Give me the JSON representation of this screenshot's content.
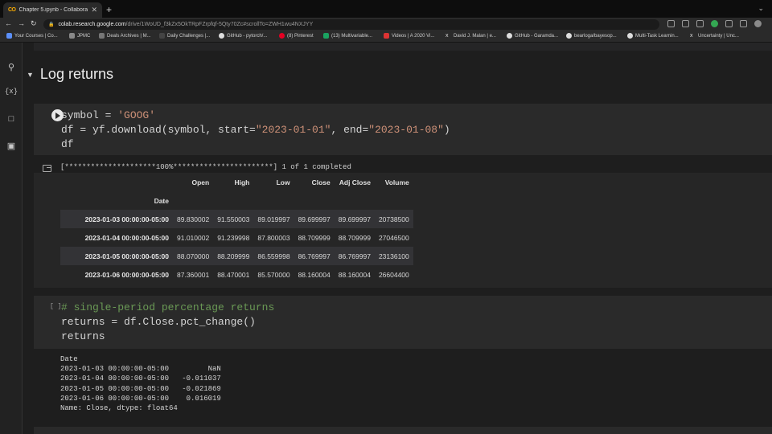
{
  "browser": {
    "tab": {
      "logo": "CO",
      "title": "Chapter 5.ipynb - Collaborator",
      "close": "✕"
    },
    "new_tab": "+",
    "window_ctl": "⌄",
    "url_host": "colab.research.google.com",
    "url_path": "/drive/1WoUD_f3kZx5OkTRpFZrpfqf-5Qty70Zc#scrollTo=ZWH1wu4NXJYY",
    "bookmarks": [
      "Your Courses | Co...",
      "JPMC",
      "Deals Archives | M...",
      "Daily Challenges |...",
      "GitHub - pytorch/...",
      "(8) Pinterest",
      "(13) Multivariable...",
      "Videos | A 2020 Vi...",
      "David J. Malan | e...",
      "GitHub - Garamda...",
      "bearloga/bayesop...",
      "Multi-Task Learnin...",
      "Uncertainty | Unc..."
    ]
  },
  "section": {
    "title": "Log returns"
  },
  "cell1": {
    "line1_a": "symbol = ",
    "line1_str": "'GOOG'",
    "line2_a": "df = yf.download(symbol, start=",
    "line2_s1": "\"2023-01-01\"",
    "line2_b": ", end=",
    "line2_s2": "\"2023-01-08\"",
    "line2_c": ")",
    "line3": "df"
  },
  "output1": {
    "progress": "[*********************100%***********************]  1 of 1 completed",
    "columns": [
      "Open",
      "High",
      "Low",
      "Close",
      "Adj Close",
      "Volume"
    ],
    "index_name": "Date",
    "rows": [
      {
        "date": "2023-01-03 00:00:00-05:00",
        "open": "89.830002",
        "high": "91.550003",
        "low": "89.019997",
        "close": "89.699997",
        "adj": "89.699997",
        "vol": "20738500"
      },
      {
        "date": "2023-01-04 00:00:00-05:00",
        "open": "91.010002",
        "high": "91.239998",
        "low": "87.800003",
        "close": "88.709999",
        "adj": "88.709999",
        "vol": "27046500"
      },
      {
        "date": "2023-01-05 00:00:00-05:00",
        "open": "88.070000",
        "high": "88.209999",
        "low": "86.559998",
        "close": "86.769997",
        "adj": "86.769997",
        "vol": "23136100"
      },
      {
        "date": "2023-01-06 00:00:00-05:00",
        "open": "87.360001",
        "high": "88.470001",
        "low": "85.570000",
        "close": "88.160004",
        "adj": "88.160004",
        "vol": "26604400"
      }
    ]
  },
  "cell2": {
    "prompt": "[ ]",
    "comment": "# single-period percentage returns",
    "line2": "returns = df.Close.pct_change()",
    "line3": "returns"
  },
  "output2": {
    "header": "Date",
    "lines": [
      "2023-01-03 00:00:00-05:00         NaN",
      "2023-01-04 00:00:00-05:00   -0.011037",
      "2023-01-05 00:00:00-05:00   -0.021869",
      "2023-01-06 00:00:00-05:00    0.016019"
    ],
    "footer": "Name: Close, dtype: float64"
  }
}
